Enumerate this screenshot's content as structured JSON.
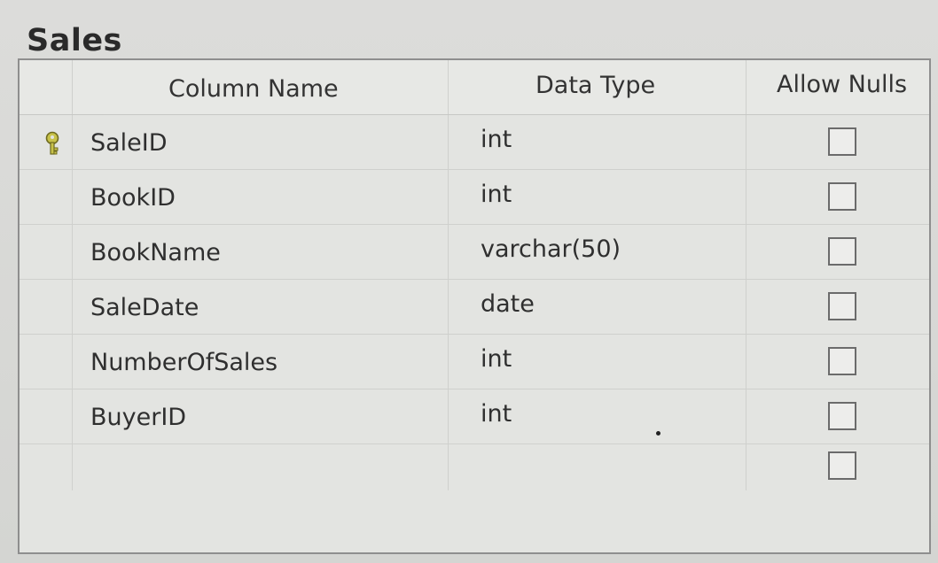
{
  "table": {
    "title": "Sales"
  },
  "headers": {
    "column_name": "Column Name",
    "data_type": "Data Type",
    "allow_nulls": "Allow Nulls"
  },
  "rows": [
    {
      "name": "SaleID",
      "type": "int",
      "allow_nulls": false,
      "primary_key": true
    },
    {
      "name": "BookID",
      "type": "int",
      "allow_nulls": false,
      "primary_key": false
    },
    {
      "name": "BookName",
      "type": "varchar(50)",
      "allow_nulls": false,
      "primary_key": false
    },
    {
      "name": "SaleDate",
      "type": "date",
      "allow_nulls": false,
      "primary_key": false
    },
    {
      "name": "NumberOfSales",
      "type": "int",
      "allow_nulls": false,
      "primary_key": false
    },
    {
      "name": "BuyerID",
      "type": "int",
      "allow_nulls": false,
      "primary_key": false
    },
    {
      "name": "",
      "type": "",
      "allow_nulls": false,
      "primary_key": false
    }
  ],
  "icons": {
    "primary_key": "key-icon"
  },
  "colors": {
    "key_icon": "#c8c24a",
    "background": "#d9d9d7"
  }
}
